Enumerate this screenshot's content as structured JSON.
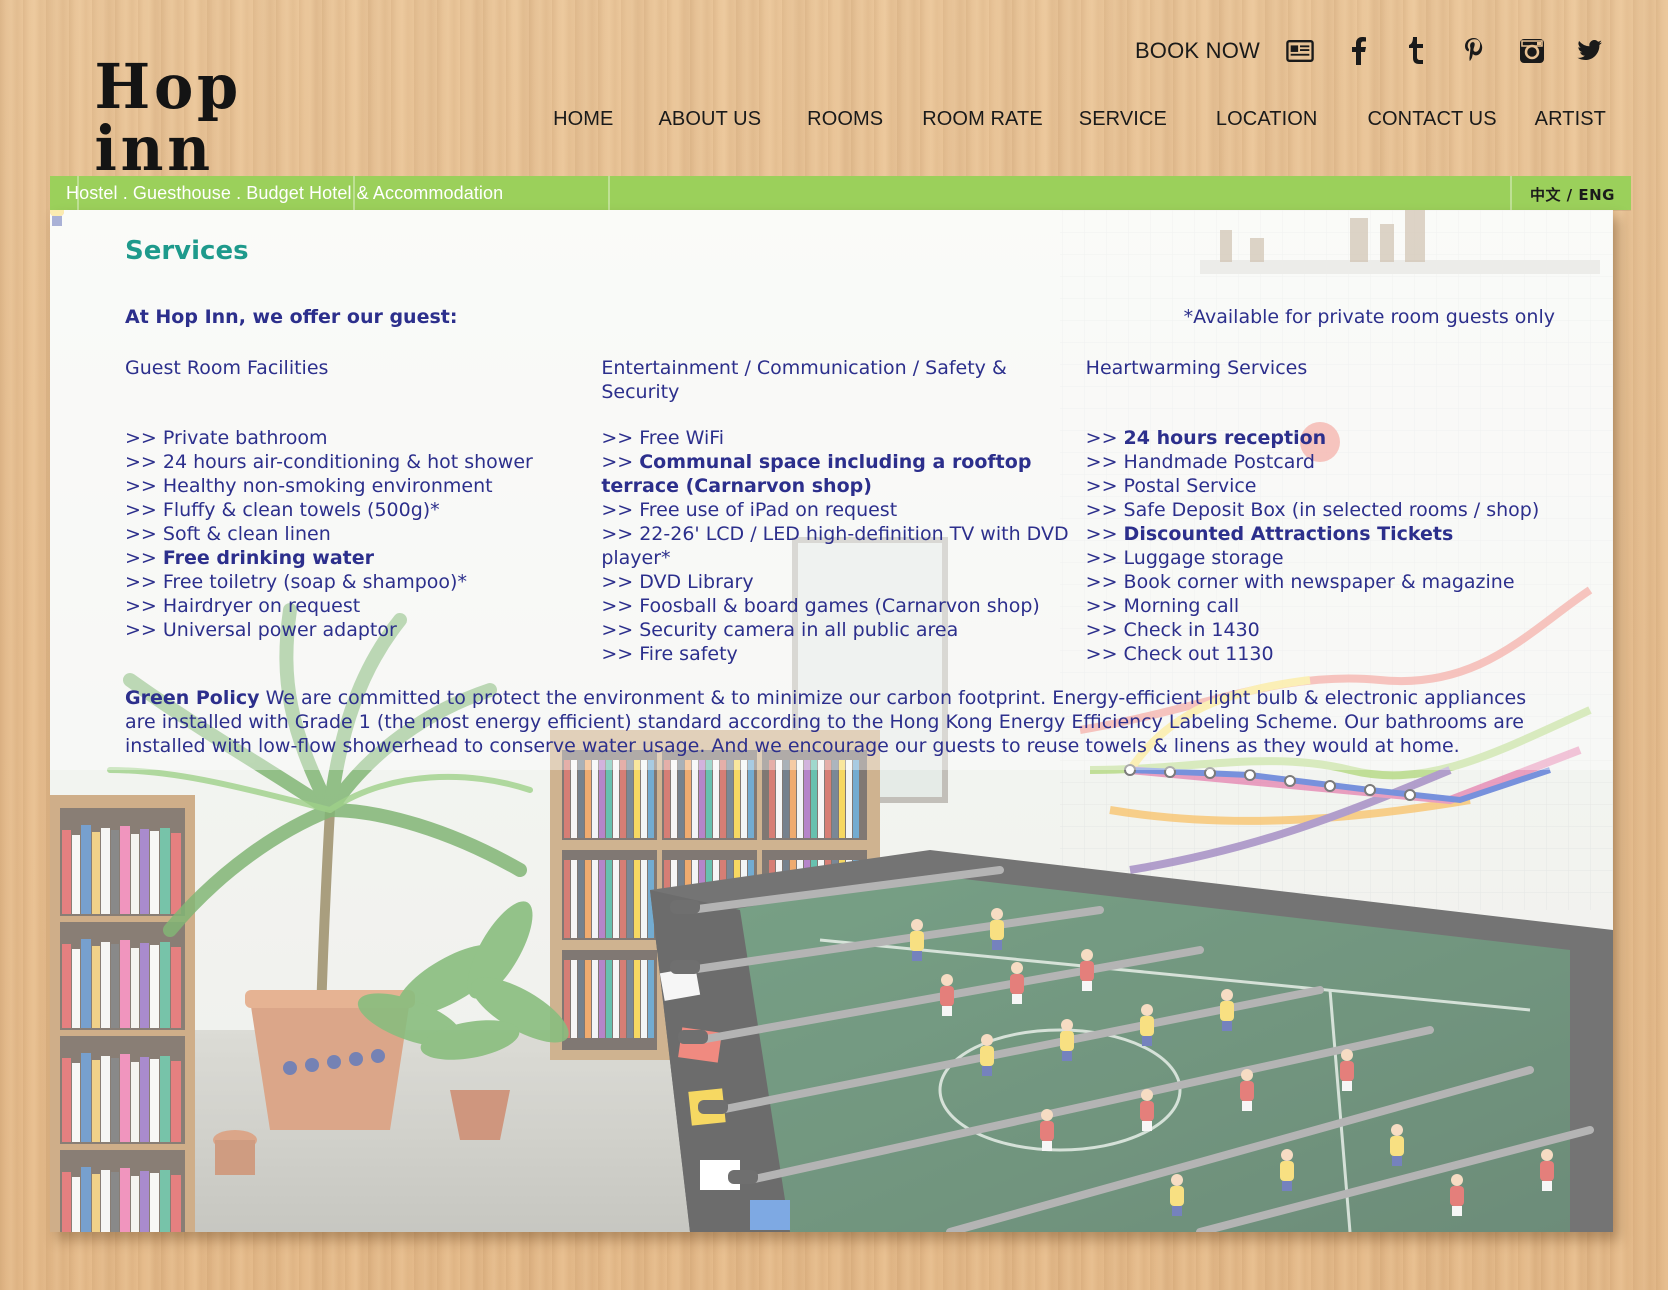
{
  "header": {
    "logo_text": "Hop inn",
    "book_now": "BOOK NOW",
    "social_icons": [
      "newsletter-icon",
      "facebook-icon",
      "tumblr-icon",
      "pinterest-icon",
      "instagram-icon",
      "twitter-icon"
    ],
    "nav": [
      "HOME",
      "ABOUT US",
      "ROOMS",
      "ROOM RATE",
      "SERVICE",
      "LOCATION",
      "CONTACT US",
      "ARTIST"
    ]
  },
  "banner": {
    "tagline": "Hostel . Guesthouse . Budget Hotel & Accommodation",
    "lang_switch": "中文 / ENG",
    "color": "#9bd05b"
  },
  "content": {
    "title": "Services",
    "intro": "At Hop Inn, we offer our guest:",
    "note": "*Available for private room guests only",
    "columns": [
      {
        "heading": "Guest Room Facilities",
        "items": [
          {
            "prefix": ">> ",
            "text": "Private bathroom",
            "bold": false
          },
          {
            "prefix": ">> ",
            "text": "24 hours air-conditioning & hot shower",
            "bold": false
          },
          {
            "prefix": ">> ",
            "text": "Healthy non-smoking environment",
            "bold": false
          },
          {
            "prefix": ">> ",
            "text": "Fluffy & clean towels (500g)*",
            "bold": false
          },
          {
            "prefix": ">> ",
            "text": "Soft & clean linen",
            "bold": false
          },
          {
            "prefix": ">> ",
            "text": "Free drinking water",
            "bold": true
          },
          {
            "prefix": ">> ",
            "text": "Free toiletry (soap & shampoo)*",
            "bold": false
          },
          {
            "prefix": ">> ",
            "text": "Hairdryer on request",
            "bold": false
          },
          {
            "prefix": ">> ",
            "text": "Universal power adaptor",
            "bold": false
          }
        ]
      },
      {
        "heading": "Entertainment / Communication / Safety & Security",
        "items": [
          {
            "prefix": ">> ",
            "text": "Free WiFi",
            "bold": false
          },
          {
            "prefix": ">> ",
            "text": "Communal space including a rooftop terrace (Carnarvon shop)",
            "bold": true
          },
          {
            "prefix": ">> ",
            "text": "Free use of iPad on request",
            "bold": false
          },
          {
            "prefix": ">> ",
            "text": "22-26' LCD / LED high-definition TV with DVD player*",
            "bold": false
          },
          {
            "prefix": ">> ",
            "text": "DVD Library",
            "bold": false
          },
          {
            "prefix": ">> ",
            "text": "Foosball & board games (Carnarvon shop)",
            "bold": false
          },
          {
            "prefix": ">> ",
            "text": "Security camera in all public area",
            "bold": false
          },
          {
            "prefix": ">> ",
            "text": "Fire safety",
            "bold": false
          }
        ]
      },
      {
        "heading": "Heartwarming Services",
        "items": [
          {
            "prefix": ">> ",
            "text": "24 hours reception",
            "bold": true
          },
          {
            "prefix": ">> ",
            "text": "Handmade Postcard",
            "bold": false
          },
          {
            "prefix": ">> ",
            "text": "Postal Service",
            "bold": false
          },
          {
            "prefix": ">> ",
            "text": "Safe Deposit Box (in selected rooms / shop)",
            "bold": false
          },
          {
            "prefix": ">> ",
            "text": "Discounted Attractions Tickets",
            "bold": true
          },
          {
            "prefix": ">> ",
            "text": "Luggage storage",
            "bold": false
          },
          {
            "prefix": ">> ",
            "text": "Book corner with newspaper & magazine",
            "bold": false
          },
          {
            "prefix": ">> ",
            "text": "Morning call",
            "bold": false
          },
          {
            "prefix": ">> ",
            "text": "Check in 1430",
            "bold": false
          },
          {
            "prefix": ">> ",
            "text": "Check out 1130",
            "bold": false
          }
        ]
      }
    ],
    "green_policy_label": "Green Policy",
    "green_policy_text": " We are committed to protect the environment & to minimize our carbon footprint. Energy-efficient light bulb & electronic appliances are installed with Grade 1 (the most energy efficient) standard according to the Hong Kong Energy Efficiency Labeling Scheme. Our bathrooms are installed with low-flow showerhead to conserve water usage. And we encourage our guests to reuse towels & linens as they would at home."
  },
  "colors": {
    "title": "#1e9a8c",
    "text": "#2c2f8c"
  }
}
